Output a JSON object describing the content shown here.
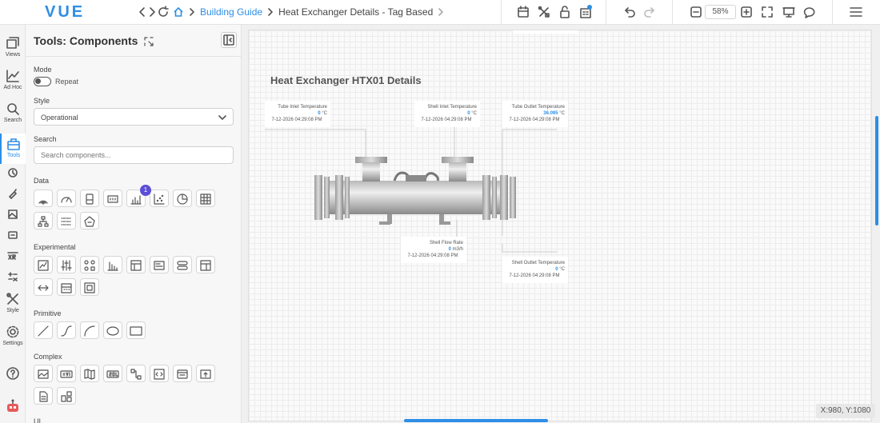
{
  "app": {
    "logo": "VUE"
  },
  "breadcrumb": {
    "items": [
      "Building Guide",
      "Heat Exchanger Details - Tag Based"
    ]
  },
  "toolbar": {
    "zoom": "58%"
  },
  "rail": {
    "views": "Views",
    "adhoc": "Ad Hoc",
    "search": "Search",
    "tools": "Tools",
    "style": "Style",
    "settings": "Settings"
  },
  "panel": {
    "title": "Tools: Components",
    "mode_label": "Mode",
    "repeat_label": "Repeat",
    "style_label": "Style",
    "style_value": "Operational",
    "search_label": "Search",
    "search_placeholder": "Search components...",
    "sections": {
      "data": "Data",
      "experimental": "Experimental",
      "primitive": "Primitive",
      "complex": "Complex",
      "ui": "UI"
    },
    "data_badge": "1",
    "icons": {
      "data": [
        "signal-icon",
        "gauge-icon",
        "tank-icon",
        "numeric-icon",
        "bar-chart-icon",
        "scatter-icon",
        "pie-icon",
        "table-icon",
        "hierarchy-icon",
        "heatmap-icon",
        "building-icon"
      ],
      "experimental": [
        "line-chart-icon",
        "sliders-icon",
        "nodes-icon",
        "column-chart-icon",
        "data-table-icon",
        "card-icon",
        "toggle-list-icon",
        "layout-icon",
        "arrows-icon",
        "calendar-icon",
        "grid-icon"
      ],
      "primitive": [
        "line-icon",
        "curve-icon",
        "arc-icon",
        "ellipse-icon",
        "rectangle-icon"
      ],
      "complex": [
        "image-icon",
        "svg-icon",
        "map-icon",
        "sql-icon",
        "flow-icon",
        "embed-icon",
        "window-icon",
        "upload-icon",
        "document-icon",
        "widgets-icon"
      ]
    }
  },
  "dashboard": {
    "title": "Heat Exchanger HTX01 Details",
    "tags": [
      {
        "label": "Tube Inlet Temperature",
        "value": "0",
        "unit": "°C",
        "time": "7-12-2026 04:29:08 PM"
      },
      {
        "label": "Shell Inlet Temperature",
        "value": "0",
        "unit": "°C",
        "time": "7-12-2026 04:29:08 PM"
      },
      {
        "label": "Tube Outlet Temperature",
        "value": "36.095",
        "unit": "°C",
        "time": "7-12-2026 04:29:08 PM"
      },
      {
        "label": "Shell Flow Rate",
        "value": "0",
        "unit": "m3/h",
        "time": "7-12-2026 04:29:08 PM"
      },
      {
        "label": "Shell Outlet Temperature",
        "value": "0",
        "unit": "°C",
        "time": "7-12-2026 04:29:08 PM"
      }
    ]
  },
  "status": {
    "coords": "X:980, Y:1080"
  },
  "colors": {
    "accent": "#2d8ee6",
    "badge": "#5b4fd6"
  }
}
